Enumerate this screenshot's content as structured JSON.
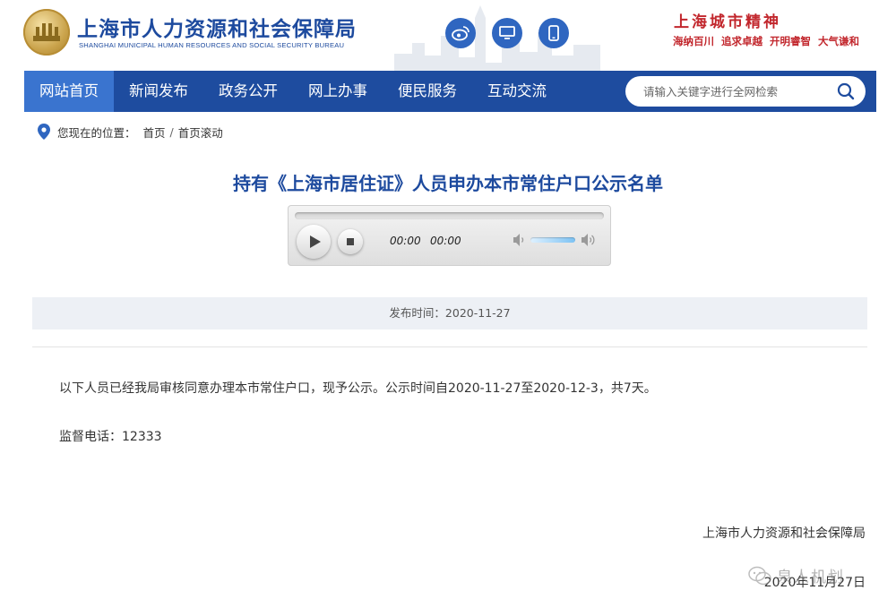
{
  "header": {
    "org_name_cn": "上海市人力资源和社会保障局",
    "org_name_en": "SHANGHAI MUNICIPAL HUMAN RESOURCES AND SOCIAL SECURITY BUREAU",
    "social_icons": [
      "weibo-icon",
      "desktop-icon",
      "mobile-icon"
    ],
    "slogan": {
      "title": "上海城市精神",
      "items": [
        "海纳百川",
        "追求卓越",
        "开明睿智",
        "大气谦和"
      ]
    }
  },
  "nav": {
    "items": [
      {
        "label": "网站首页",
        "active": true
      },
      {
        "label": "新闻发布",
        "active": false
      },
      {
        "label": "政务公开",
        "active": false
      },
      {
        "label": "网上办事",
        "active": false
      },
      {
        "label": "便民服务",
        "active": false
      },
      {
        "label": "互动交流",
        "active": false
      }
    ],
    "search_placeholder": "请输入关键字进行全网检索"
  },
  "breadcrumb": {
    "prefix": "您现在的位置：",
    "items": [
      "首页",
      "首页滚动"
    ]
  },
  "article": {
    "title": "持有《上海市居住证》人员申办本市常住户口公示名单",
    "player": {
      "current_time": "00:00",
      "duration": "00:00"
    },
    "publish_label": "发布时间：2020-11-27",
    "paragraph_1": "以下人员已经我局审核同意办理本市常住户口，现予公示。公示时间自2020-11-27至2020-12-3，共7天。",
    "paragraph_2": "监督电话：12333",
    "signature": "上海市人力资源和社会保障局",
    "sign_date": "2020年11月27日"
  },
  "watermark": {
    "text": "泉人机划"
  },
  "colors": {
    "brand_blue": "#1e4c9f",
    "nav_active": "#3a74cf",
    "slogan_red": "#c2272d",
    "title_blue": "#1d4a9e"
  }
}
